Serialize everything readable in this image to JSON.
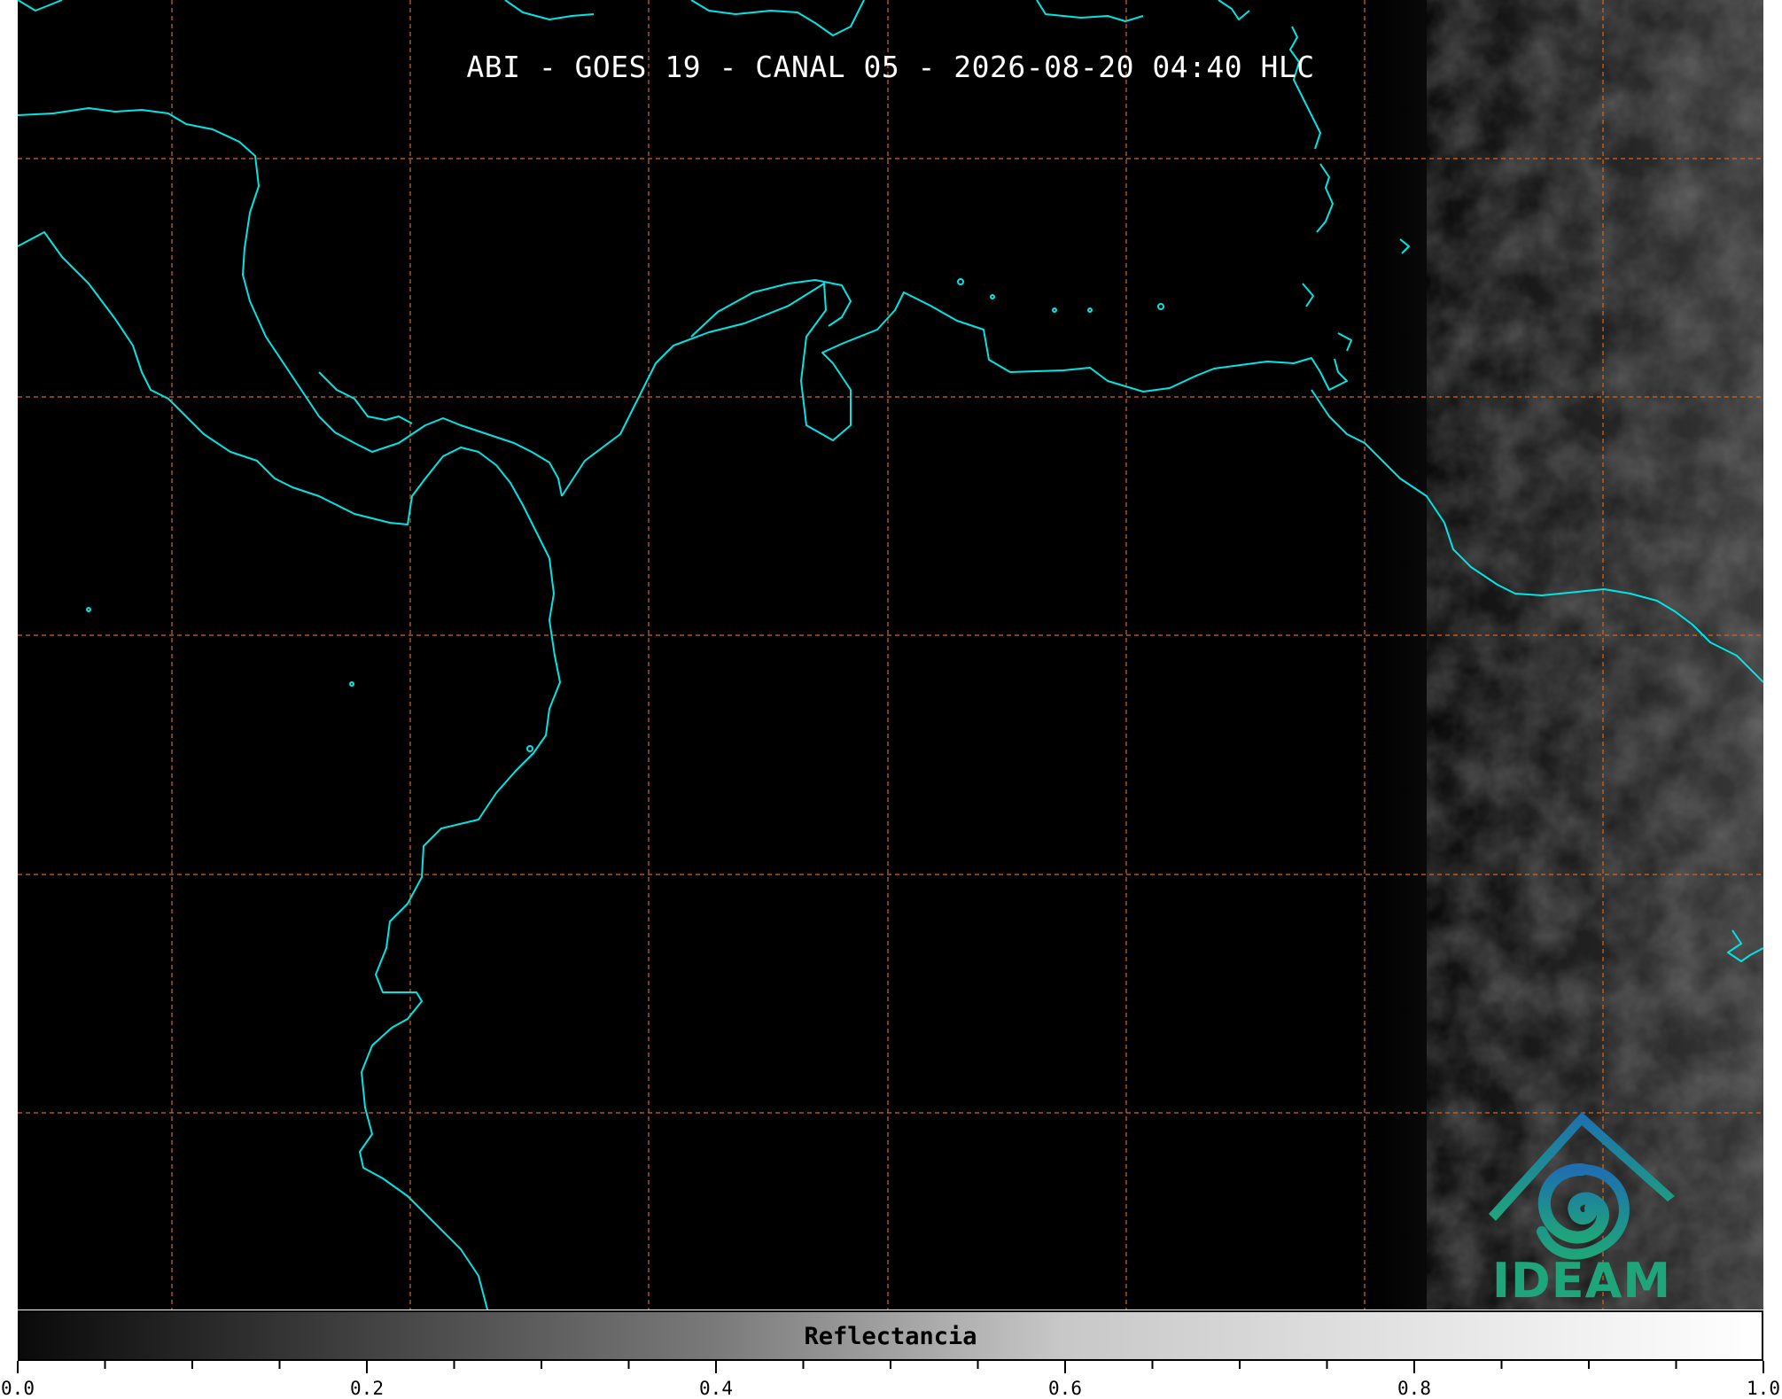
{
  "title": "ABI - GOES 19 - CANAL 05 - 2026-08-20 04:40 HLC",
  "logo": {
    "text": "IDEAM",
    "icon": "ideam-mountain-swirl-logo"
  },
  "colorbar": {
    "label": "Reflectancia",
    "range": [
      0.0,
      1.0
    ],
    "tick_labels": [
      "0.0",
      "0.2",
      "0.4",
      "0.6",
      "0.8",
      "1.0"
    ],
    "colormap": "grayscale"
  },
  "colors": {
    "background": "#000000",
    "coastline": "#00e5e5",
    "gridline": "#d2691e",
    "logo_blue": "#1e6fb0",
    "logo_green": "#1fa57a"
  },
  "map": {
    "gridlines": "dashed",
    "cloud_region": "right"
  }
}
